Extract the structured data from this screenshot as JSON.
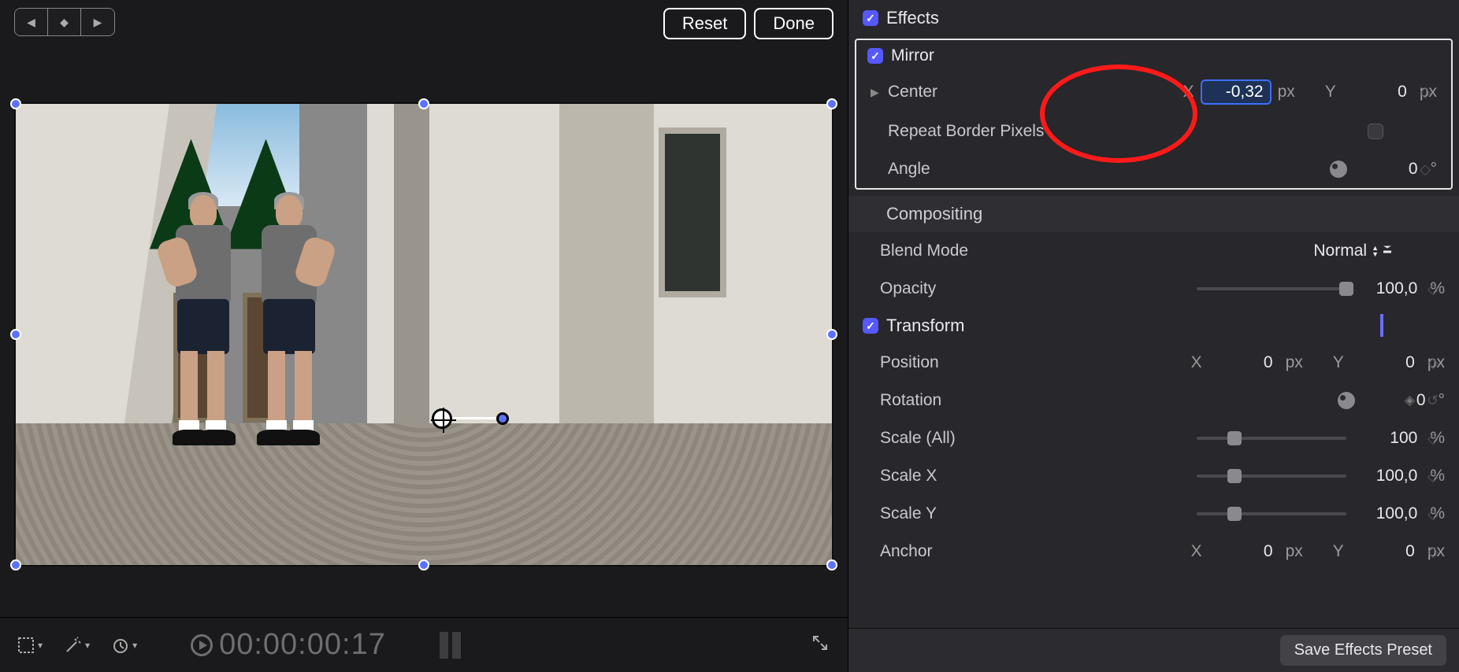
{
  "viewer": {
    "reset": "Reset",
    "done": "Done",
    "timecode": "00:00:00:17"
  },
  "inspector": {
    "effects_title": "Effects",
    "mirror": {
      "title": "Mirror",
      "center_label": "Center",
      "center_x_label": "X",
      "center_x_value": "-0,32",
      "center_x_unit": "px",
      "center_y_label": "Y",
      "center_y_value": "0",
      "center_y_unit": "px",
      "repeat_label": "Repeat Border Pixels",
      "angle_label": "Angle",
      "angle_value": "0",
      "angle_unit": "°"
    },
    "compositing": {
      "title": "Compositing",
      "blend_label": "Blend Mode",
      "blend_value": "Normal",
      "opacity_label": "Opacity",
      "opacity_value": "100,0",
      "opacity_unit": "%"
    },
    "transform": {
      "title": "Transform",
      "position_label": "Position",
      "pos_x_label": "X",
      "pos_x_value": "0",
      "pos_x_unit": "px",
      "pos_y_label": "Y",
      "pos_y_value": "0",
      "pos_y_unit": "px",
      "rotation_label": "Rotation",
      "rotation_value": "0",
      "rotation_unit": "°",
      "scale_all_label": "Scale (All)",
      "scale_all_value": "100",
      "scale_all_unit": "%",
      "scale_x_label": "Scale X",
      "scale_x_value": "100,0",
      "scale_x_unit": "%",
      "scale_y_label": "Scale Y",
      "scale_y_value": "100,0",
      "scale_y_unit": "%",
      "anchor_label": "Anchor",
      "anchor_x_label": "X",
      "anchor_x_value": "0",
      "anchor_x_unit": "px",
      "anchor_y_label": "Y",
      "anchor_y_value": "0",
      "anchor_y_unit": "px"
    },
    "save_preset": "Save Effects Preset"
  }
}
